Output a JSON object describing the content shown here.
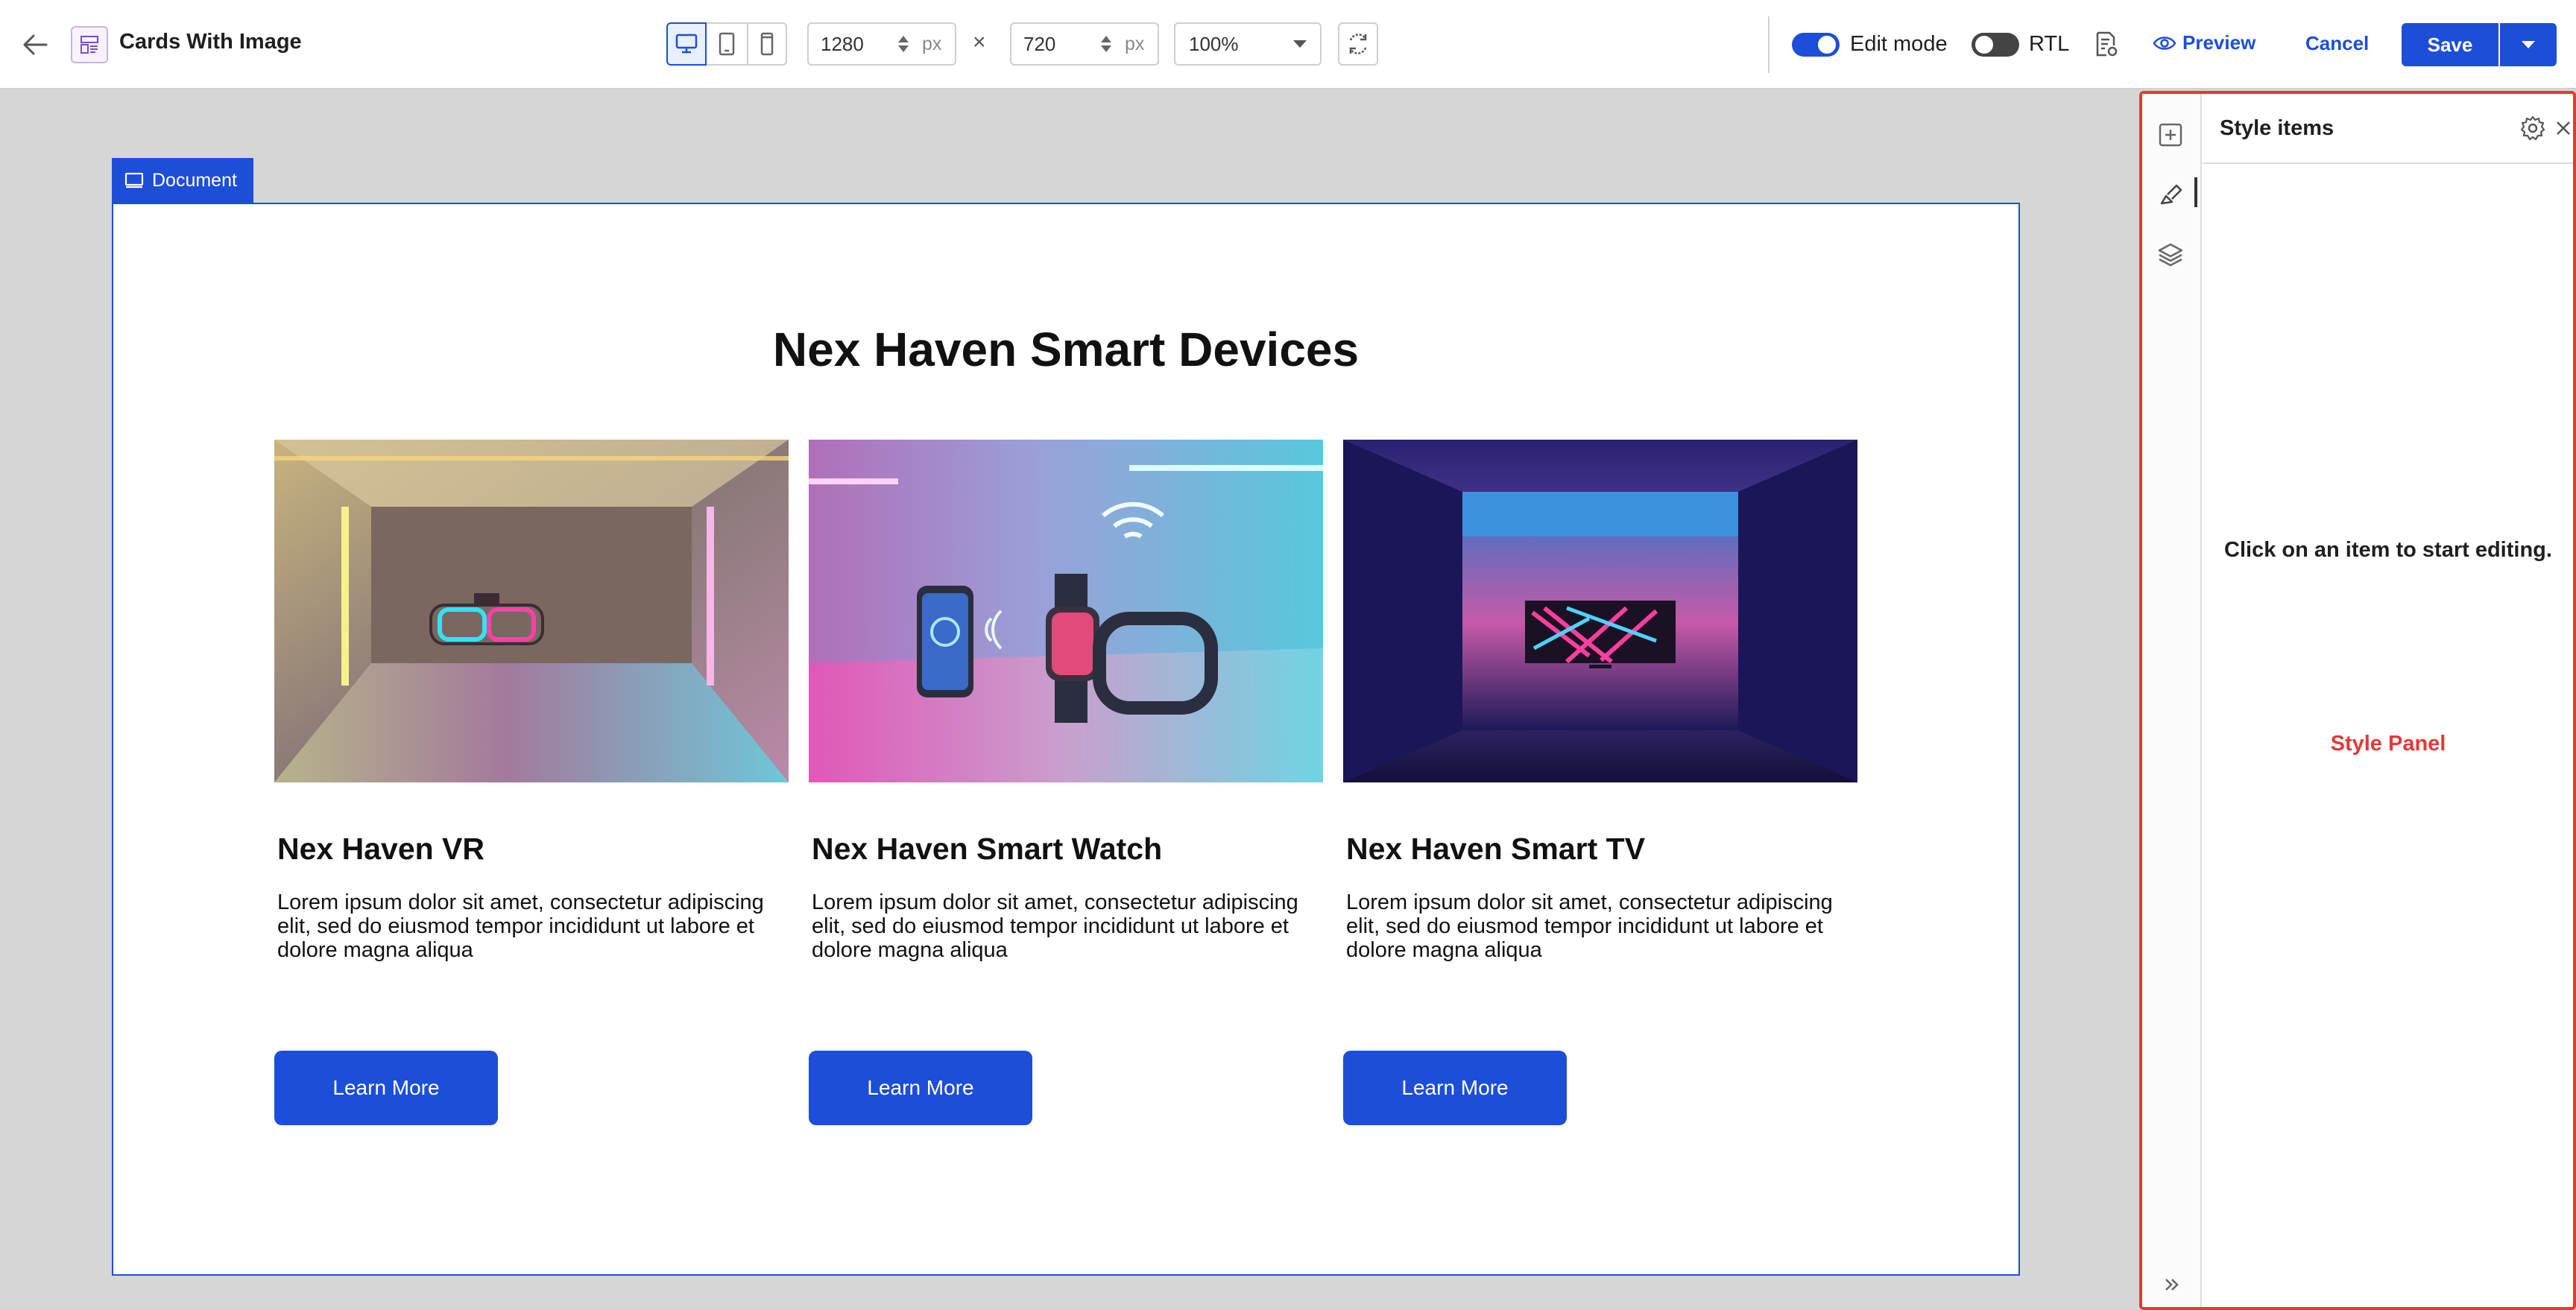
{
  "toolbar": {
    "title": "Cards With Image",
    "width_value": "1280",
    "height_value": "720",
    "unit": "px",
    "times": "×",
    "zoom": "100%",
    "edit_mode_label": "Edit mode",
    "edit_mode_on": true,
    "rtl_label": "RTL",
    "rtl_on": false,
    "preview_label": "Preview",
    "cancel_label": "Cancel",
    "save_label": "Save",
    "active_device": "desktop",
    "icons": [
      "back-arrow-icon",
      "template-icon",
      "desktop-icon",
      "tablet-icon",
      "mobile-icon",
      "rotate-icon",
      "page-settings-icon",
      "eye-icon",
      "chevron-down-icon"
    ]
  },
  "canvas": {
    "document_label": "Document",
    "heading": "Nex Haven Smart Devices",
    "cards": [
      {
        "title": "Nex Haven VR",
        "text": "Lorem ipsum dolor sit amet, consectetur adipiscing elit, sed do eiusmod tempor incididunt ut labore et dolore magna aliqua",
        "button": "Learn More"
      },
      {
        "title": "Nex Haven Smart Watch",
        "text": "Lorem ipsum dolor sit amet, consectetur adipiscing elit, sed do eiusmod tempor incididunt ut labore et dolore magna aliqua",
        "button": "Learn More"
      },
      {
        "title": "Nex Haven Smart TV",
        "text": "Lorem ipsum dolor sit amet, consectetur adipiscing elit, sed do eiusmod tempor incididunt ut labore et dolore magna aliqua",
        "button": "Learn More"
      }
    ]
  },
  "panel": {
    "title": "Style items",
    "hint": "Click on an item to start editing.",
    "annotation": "Style Panel",
    "rail_icons": [
      "add-icon",
      "brush-icon",
      "layers-icon",
      "expand-icon"
    ]
  },
  "colors": {
    "accent": "#1d4ed8",
    "annotation": "#e53935",
    "canvas_bg": "#d6d6d6"
  }
}
